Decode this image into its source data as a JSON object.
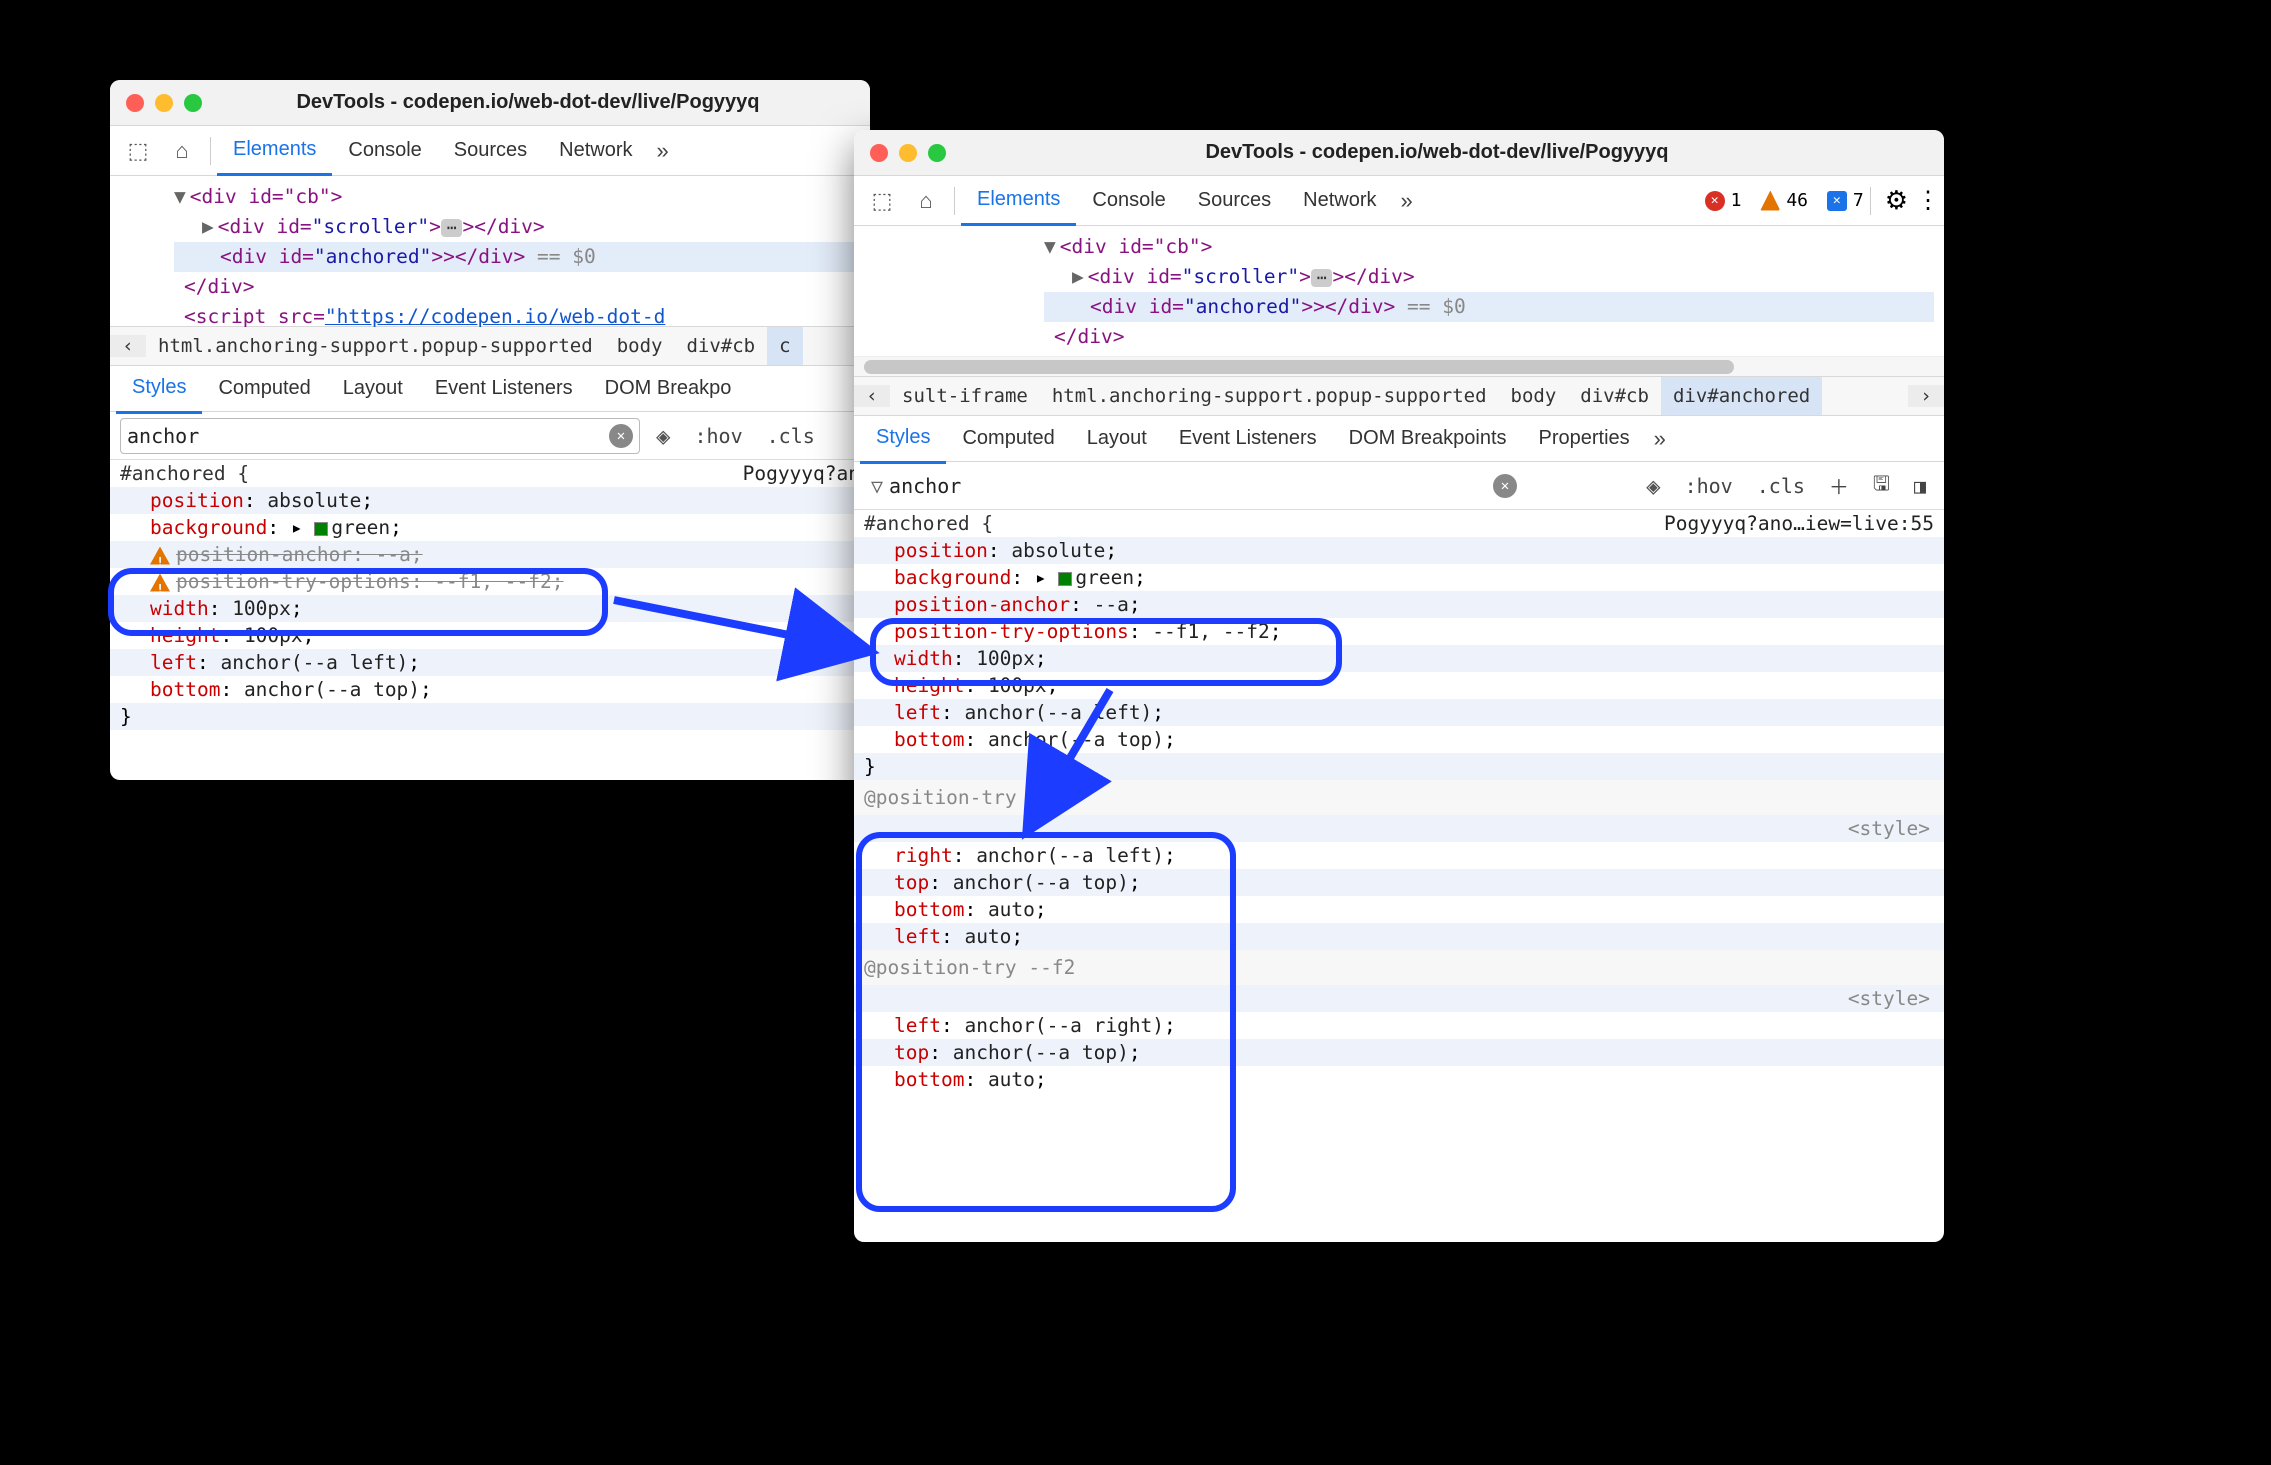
{
  "win1": {
    "title": "DevTools - codepen.io/web-dot-dev/live/Pogyyyq",
    "tabs": {
      "elements": "Elements",
      "console": "Console",
      "sources": "Sources",
      "network": "Network"
    },
    "dom": {
      "l1": "<div id=\"cb\">",
      "l2a": "<div id=",
      "l2b": "\"scroller\"",
      "l2c": "></div>",
      "l3a": "<div id=",
      "l3b": "\"anchored\"",
      "l3c": "></div>",
      "l3hint": " == $0",
      "l4": "</div>",
      "l5a": "<script src=",
      "l5b": "\"https://codepen.io/web-dot-d"
    },
    "crumbs": {
      "c1": "html.anchoring-support.popup-supported",
      "c2": "body",
      "c3": "div#cb"
    },
    "subtabs": {
      "styles": "Styles",
      "computed": "Computed",
      "layout": "Layout",
      "ev": "Event Listeners",
      "bp": "DOM Breakpo"
    },
    "filter": {
      "value": "anchor",
      "hov": ":hov",
      "cls": ".cls"
    },
    "css": {
      "sel": "#anchored {",
      "src": "Pogyyyq?an",
      "p1": {
        "k": "position",
        "v": "absolute"
      },
      "p2": {
        "k": "background",
        "v": "green"
      },
      "p3": {
        "k": "position-anchor",
        "v": "--a"
      },
      "p4": {
        "k": "position-try-options",
        "v": "--f1, --f2"
      },
      "p5": {
        "k": "width",
        "v": "100px"
      },
      "p6": {
        "k": "height",
        "v": "100px"
      },
      "p7": {
        "k": "left",
        "v": "anchor(--a left)"
      },
      "p8": {
        "k": "bottom",
        "v": "anchor(--a top)"
      },
      "close": "}"
    }
  },
  "win2": {
    "title": "DevTools - codepen.io/web-dot-dev/live/Pogyyyq",
    "tabs": {
      "elements": "Elements",
      "console": "Console",
      "sources": "Sources",
      "network": "Network"
    },
    "badges": {
      "errors": "1",
      "warns": "46",
      "info": "7"
    },
    "dom": {
      "l1": "<div id=\"cb\">",
      "l2a": "<div id=",
      "l2b": "\"scroller\"",
      "l2c": "></div>",
      "l3a": "<div id=",
      "l3b": "\"anchored\"",
      "l3c": "></div>",
      "l3hint": " == $0",
      "l4": "</div>"
    },
    "crumbs": {
      "c0": "sult-iframe",
      "c1": "html.anchoring-support.popup-supported",
      "c2": "body",
      "c3": "div#cb",
      "c4": "div#anchored"
    },
    "subtabs": {
      "styles": "Styles",
      "computed": "Computed",
      "layout": "Layout",
      "ev": "Event Listeners",
      "bp": "DOM Breakpoints",
      "props": "Properties"
    },
    "filter": {
      "value": "anchor",
      "hov": ":hov",
      "cls": ".cls"
    },
    "css": {
      "sel": "#anchored {",
      "src": "Pogyyyq?ano…iew=live:55",
      "p1": {
        "k": "position",
        "v": "absolute"
      },
      "p2": {
        "k": "background",
        "v": "green"
      },
      "p3": {
        "k": "position-anchor",
        "v": "--a"
      },
      "p4": {
        "k": "position-try-options",
        "v": "--f1, --f2"
      },
      "p5": {
        "k": "width",
        "v": "100px"
      },
      "p6": {
        "k": "height",
        "v": "100px"
      },
      "p7": {
        "k": "left",
        "v": "anchor(--a left)"
      },
      "p8": {
        "k": "bottom",
        "v": "anchor(--a top)"
      },
      "close": "}",
      "try1head": "@position-try --f1",
      "styletag": "<style>",
      "t1": {
        "k": "right",
        "v": "anchor(--a left)"
      },
      "t2": {
        "k": "top",
        "v": "anchor(--a top)"
      },
      "t3": {
        "k": "bottom",
        "v": "auto"
      },
      "t4": {
        "k": "left",
        "v": "auto"
      },
      "try2head": "@position-try --f2",
      "u1": {
        "k": "left",
        "v": "anchor(--a right)"
      },
      "u2": {
        "k": "top",
        "v": "anchor(--a top)"
      },
      "u3": {
        "k": "bottom",
        "v": "auto"
      }
    }
  },
  "annotations": {
    "callouts": [
      {
        "name": "before-unsupported-props",
        "window": 1,
        "covers": [
          "position-anchor",
          "position-try-options (struck, warning)"
        ]
      },
      {
        "name": "after-supported-props",
        "window": 2,
        "covers": [
          "position-anchor",
          "position-try-options (valid)"
        ]
      },
      {
        "name": "position-try-rules",
        "window": 2,
        "covers": [
          "@position-try --f1",
          "@position-try --f2"
        ]
      }
    ],
    "arrows": [
      {
        "from": "before-unsupported-props",
        "to": "after-supported-props"
      },
      {
        "from": "after-supported-props",
        "to": "position-try-rules"
      }
    ]
  }
}
